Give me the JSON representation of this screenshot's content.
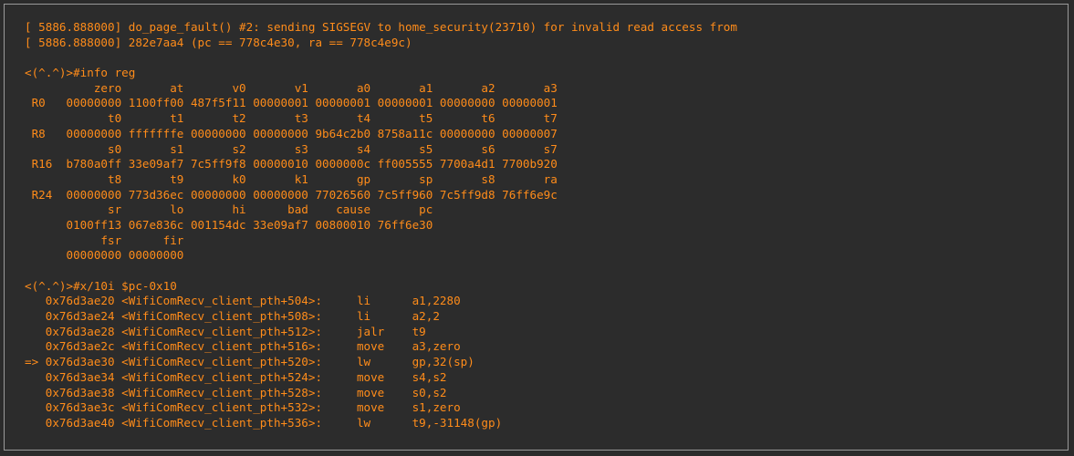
{
  "terminal": {
    "kernel_log": [
      "[ 5886.888000] do_page_fault() #2: sending SIGSEGV to home_security(23710) for invalid read access from",
      "[ 5886.888000] 282e7aa4 (pc == 778c4e30, ra == 778c4e9c)"
    ],
    "command_info_reg": "<(^.^)>#info reg",
    "registers": [
      "          zero       at       v0       v1       a0       a1       a2       a3",
      " R0   00000000 1100ff00 487f5f11 00000001 00000001 00000001 00000000 00000001",
      "            t0       t1       t2       t3       t4       t5       t6       t7",
      " R8   00000000 fffffffe 00000000 00000000 9b64c2b0 8758a11c 00000000 00000007",
      "            s0       s1       s2       s3       s4       s5       s6       s7",
      " R16  b780a0ff 33e09af7 7c5ff9f8 00000010 0000000c ff005555 7700a4d1 7700b920",
      "            t8       t9       k0       k1       gp       sp       s8       ra",
      " R24  00000000 773d36ec 00000000 00000000 77026560 7c5ff960 7c5ff9d8 76ff6e9c",
      "            sr       lo       hi      bad    cause       pc",
      "      0100ff13 067e836c 001154dc 33e09af7 00800010 76ff6e30",
      "           fsr      fir",
      "      00000000 00000000"
    ],
    "command_disasm": "<(^.^)>#x/10i $pc-0x10",
    "disassembly": [
      "   0x76d3ae20 <WifiComRecv_client_pth+504>:     li      a1,2280",
      "   0x76d3ae24 <WifiComRecv_client_pth+508>:     li      a2,2",
      "   0x76d3ae28 <WifiComRecv_client_pth+512>:     jalr    t9",
      "   0x76d3ae2c <WifiComRecv_client_pth+516>:     move    a3,zero",
      "=> 0x76d3ae30 <WifiComRecv_client_pth+520>:     lw      gp,32(sp)",
      "   0x76d3ae34 <WifiComRecv_client_pth+524>:     move    s4,s2",
      "   0x76d3ae38 <WifiComRecv_client_pth+528>:     move    s0,s2",
      "   0x76d3ae3c <WifiComRecv_client_pth+532>:     move    s1,zero",
      "   0x76d3ae40 <WifiComRecv_client_pth+536>:     lw      t9,-31148(gp)"
    ],
    "text_color": "#ff8c1a",
    "background_color": "#2c2c2c"
  }
}
